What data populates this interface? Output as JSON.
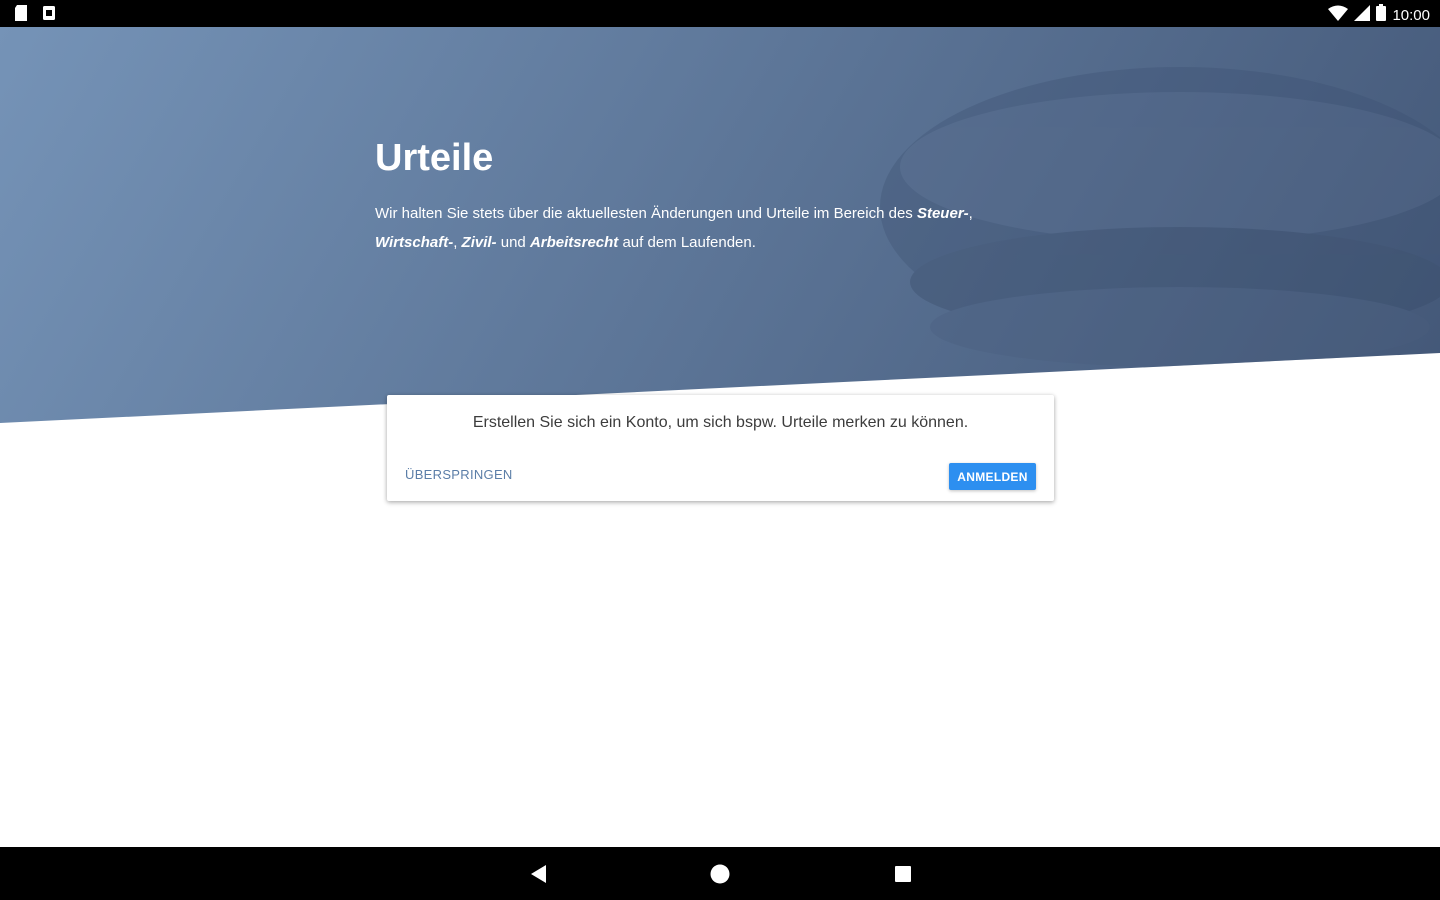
{
  "status_bar": {
    "time": "10:00",
    "left_icons": [
      "sd-card-icon",
      "notification-icon"
    ],
    "right_icons": [
      "wifi-icon",
      "signal-icon",
      "battery-icon"
    ]
  },
  "hero": {
    "title": "Urteile",
    "desc_prefix": "Wir halten Sie stets über die aktuellesten Änderungen und Urteile im Bereich des ",
    "topic_1": "Steuer-",
    "sep_1": ", ",
    "topic_2": "Wirtschaft-",
    "sep_2": ", ",
    "topic_3": "Zivil-",
    "sep_3": " und ",
    "topic_4": "Arbeitsrecht",
    "desc_suffix": " auf dem Laufenden.",
    "background_colors": [
      "#7593b7",
      "#435777"
    ]
  },
  "card": {
    "message": "Erstellen Sie sich ein Konto, um sich bspw. Urteile merken zu können.",
    "skip_label": "ÜBERSPRINGEN",
    "login_label": "ANMELDEN",
    "accent_color": "#2d8ff0"
  },
  "nav_bar": {
    "buttons": [
      "back-icon",
      "home-icon",
      "recents-icon"
    ]
  }
}
